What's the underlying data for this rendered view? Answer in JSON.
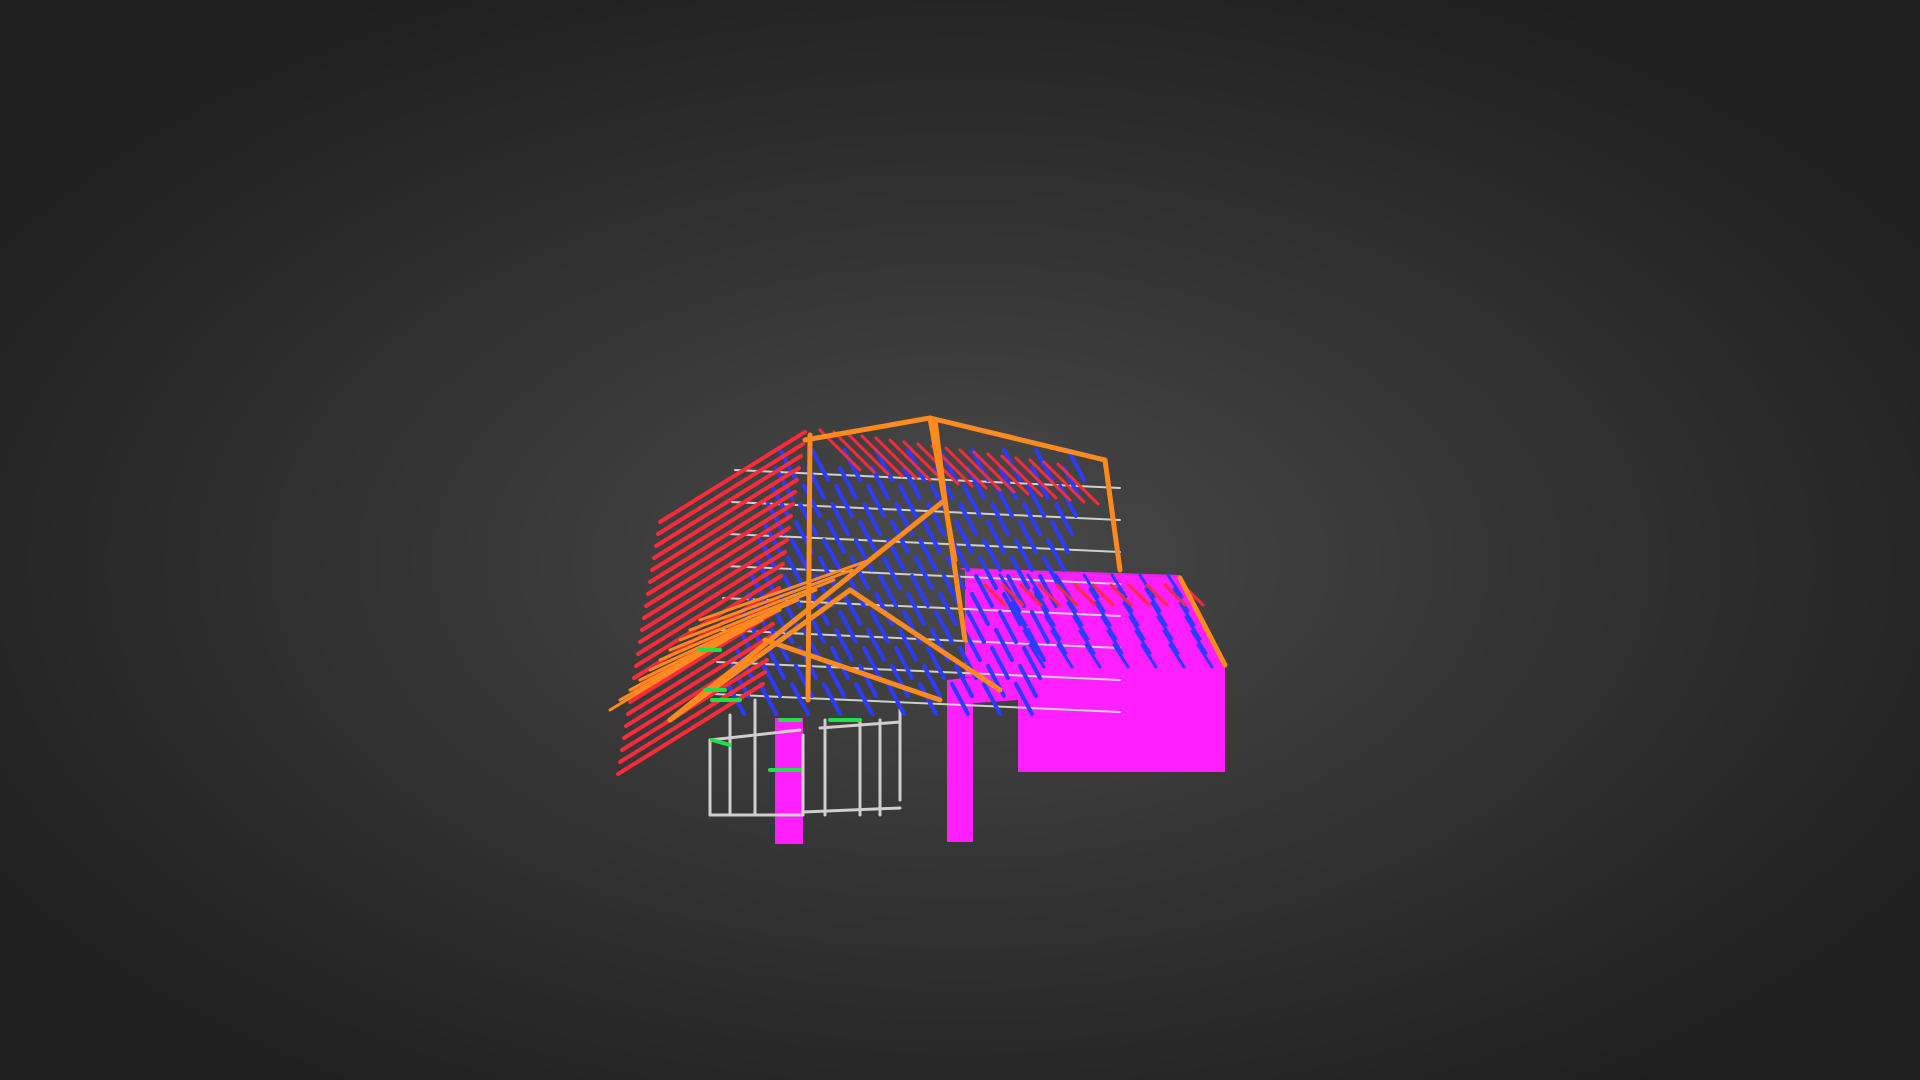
{
  "viewer": {
    "background_color": "#2f2f2f",
    "model": {
      "description_icon": "3d-roof-truss-model",
      "colors": {
        "top_chord": "#ff8a1f",
        "rafter": "#ff2a3a",
        "web_member": "#2b3cff",
        "wall_frame": "#cfcfcf",
        "panel": "#ff1fff",
        "bracing": "#22e04a"
      }
    }
  }
}
